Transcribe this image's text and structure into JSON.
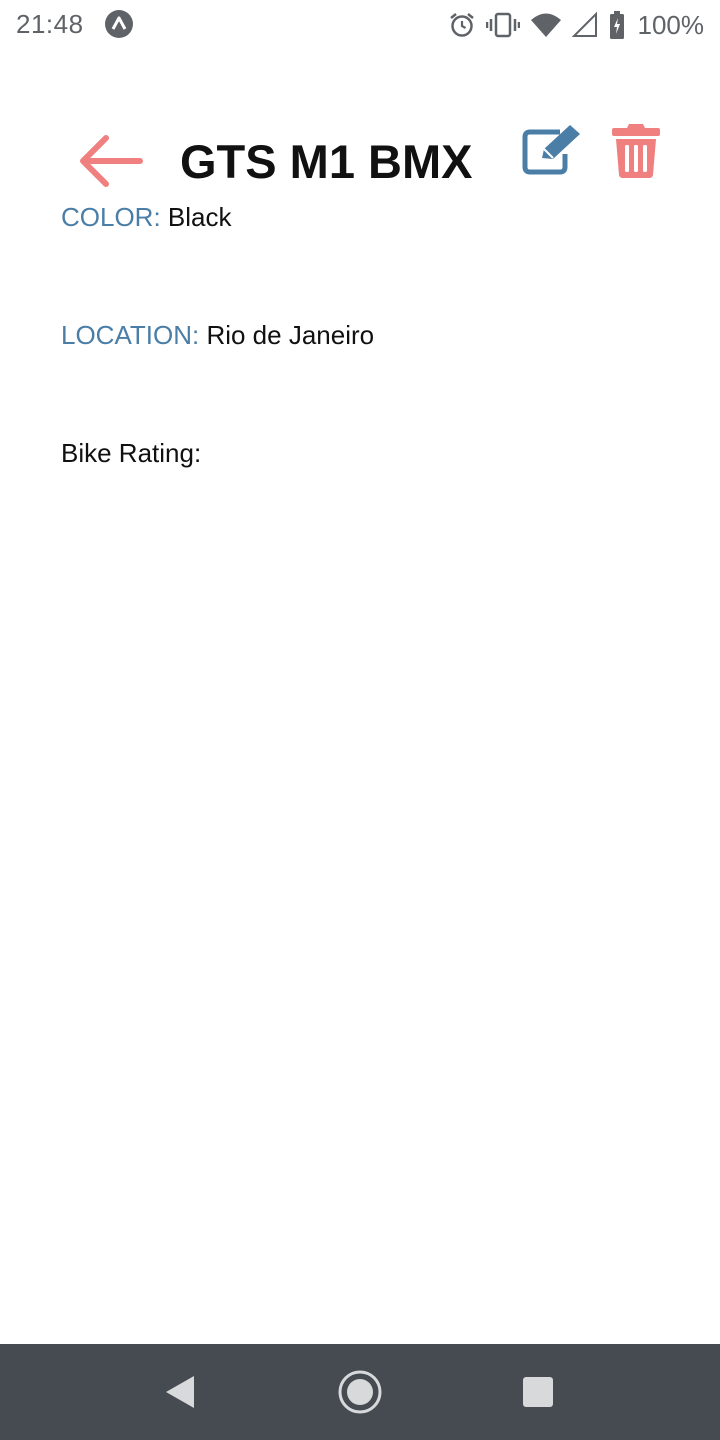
{
  "status_bar": {
    "time": "21:48",
    "battery_percent": "100%",
    "icons": [
      "app-notification-icon",
      "alarm-icon",
      "vibrate-icon",
      "wifi-icon",
      "signal-icon",
      "battery-charging-icon"
    ]
  },
  "header": {
    "title": "GTS M1 BMX",
    "back_icon": "arrow-left-icon",
    "edit_icon": "edit-icon",
    "delete_icon": "trash-icon"
  },
  "details": {
    "color_label": "COLOR:",
    "color_value": "Black",
    "location_label": "LOCATION:",
    "location_value": "Rio de Janeiro",
    "rating_label": "Bike Rating:"
  },
  "colors": {
    "accent_red": "#f08080",
    "accent_blue": "#4a7ea7",
    "text": "#111111",
    "nav_bar": "#454b51"
  },
  "nav_bar": {
    "icons": [
      "nav-back-icon",
      "nav-home-icon",
      "nav-recents-icon"
    ]
  }
}
